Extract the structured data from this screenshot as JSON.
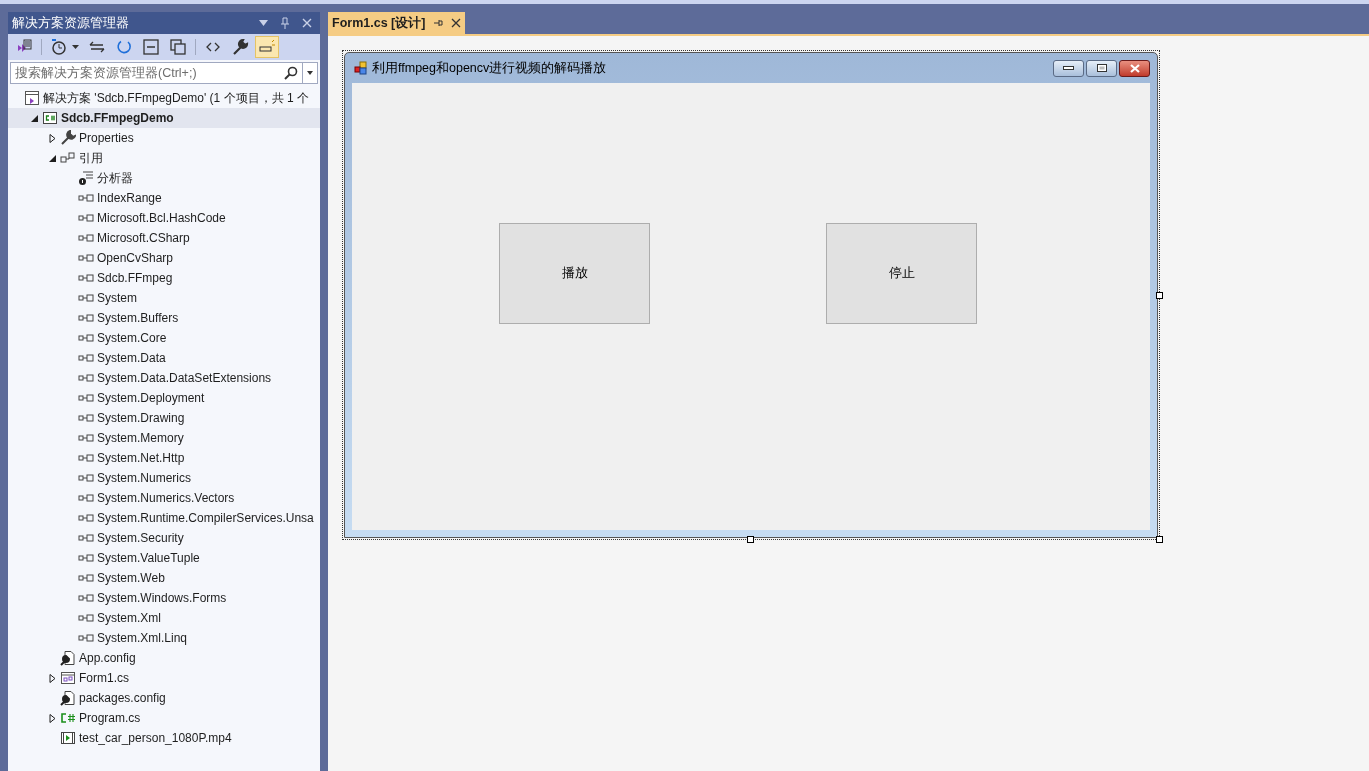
{
  "solution_explorer": {
    "title": "解决方案资源管理器",
    "search": {
      "placeholder": "搜索解决方案资源管理器(Ctrl+;)"
    },
    "toolbar": [
      {
        "kind": "vs",
        "selected": false
      },
      {
        "kind": "history",
        "selected": false
      },
      {
        "kind": "sync",
        "selected": false
      },
      {
        "kind": "refresh",
        "selected": false
      },
      {
        "kind": "collapse",
        "selected": false
      },
      {
        "kind": "copy",
        "selected": false
      },
      {
        "kind": "code",
        "selected": false
      },
      {
        "kind": "wrench",
        "selected": false
      },
      {
        "kind": "preview",
        "selected": true
      }
    ],
    "tree": [
      {
        "label": "解决方案 'Sdcb.FFmpegDemo' (1 个项目，共 1 个",
        "kind": "solution",
        "selected": false,
        "children": [
          {
            "label": "Sdcb.FFmpegDemo",
            "kind": "project",
            "selected": true,
            "expanded": true,
            "children": [
              {
                "label": "Properties",
                "kind": "properties",
                "selected": false,
                "expanded": false
              },
              {
                "label": "引用",
                "kind": "references",
                "selected": false,
                "expanded": true,
                "children": [
                  {
                    "label": "分析器",
                    "kind": "analyzer",
                    "selected": false
                  },
                  {
                    "label": "IndexRange",
                    "kind": "assembly",
                    "selected": false
                  },
                  {
                    "label": "Microsoft.Bcl.HashCode",
                    "kind": "assembly",
                    "selected": false
                  },
                  {
                    "label": "Microsoft.CSharp",
                    "kind": "assembly",
                    "selected": false
                  },
                  {
                    "label": "OpenCvSharp",
                    "kind": "assembly",
                    "selected": false
                  },
                  {
                    "label": "Sdcb.FFmpeg",
                    "kind": "assembly",
                    "selected": false
                  },
                  {
                    "label": "System",
                    "kind": "assembly",
                    "selected": false
                  },
                  {
                    "label": "System.Buffers",
                    "kind": "assembly",
                    "selected": false
                  },
                  {
                    "label": "System.Core",
                    "kind": "assembly",
                    "selected": false
                  },
                  {
                    "label": "System.Data",
                    "kind": "assembly",
                    "selected": false
                  },
                  {
                    "label": "System.Data.DataSetExtensions",
                    "kind": "assembly",
                    "selected": false
                  },
                  {
                    "label": "System.Deployment",
                    "kind": "assembly",
                    "selected": false
                  },
                  {
                    "label": "System.Drawing",
                    "kind": "assembly",
                    "selected": false
                  },
                  {
                    "label": "System.Memory",
                    "kind": "assembly",
                    "selected": false
                  },
                  {
                    "label": "System.Net.Http",
                    "kind": "assembly",
                    "selected": false
                  },
                  {
                    "label": "System.Numerics",
                    "kind": "assembly",
                    "selected": false
                  },
                  {
                    "label": "System.Numerics.Vectors",
                    "kind": "assembly",
                    "selected": false
                  },
                  {
                    "label": "System.Runtime.CompilerServices.Unsa",
                    "kind": "assembly",
                    "selected": false
                  },
                  {
                    "label": "System.Security",
                    "kind": "assembly",
                    "selected": false
                  },
                  {
                    "label": "System.ValueTuple",
                    "kind": "assembly",
                    "selected": false
                  },
                  {
                    "label": "System.Web",
                    "kind": "assembly",
                    "selected": false
                  },
                  {
                    "label": "System.Windows.Forms",
                    "kind": "assembly",
                    "selected": false
                  },
                  {
                    "label": "System.Xml",
                    "kind": "assembly",
                    "selected": false
                  },
                  {
                    "label": "System.Xml.Linq",
                    "kind": "assembly",
                    "selected": false
                  }
                ]
              },
              {
                "label": "App.config",
                "kind": "config",
                "selected": false
              },
              {
                "label": "Form1.cs",
                "kind": "form",
                "selected": false,
                "expanded": false
              },
              {
                "label": "packages.config",
                "kind": "config",
                "selected": false
              },
              {
                "label": "Program.cs",
                "kind": "csharp",
                "selected": false,
                "expanded": false
              },
              {
                "label": "test_car_person_1080P.mp4",
                "kind": "video",
                "selected": false
              }
            ]
          }
        ]
      }
    ]
  },
  "editor": {
    "tabs": [
      {
        "label": "Form1.cs [设计]",
        "selected": true
      }
    ],
    "form": {
      "title": "利用ffmpeg和opencv进行视频的解码播放",
      "buttons": [
        "播放",
        "停止"
      ]
    }
  }
}
